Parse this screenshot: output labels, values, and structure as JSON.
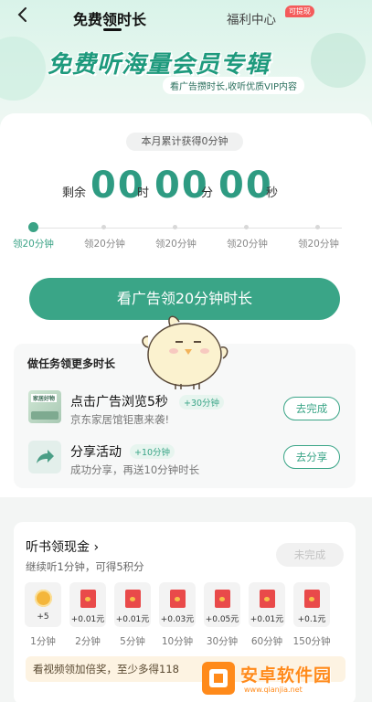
{
  "nav": {
    "back_icon": "chevron-left-icon",
    "tab_free": "免费领时长",
    "tab_welfare": "福利中心",
    "cash_tag": "可提现"
  },
  "hero": {
    "title": "免费听海量会员专辑",
    "subtitle": "看广告攒时长,收听优质VIP内容"
  },
  "timer": {
    "month_summary": "本月累计获得0分钟",
    "remain_label": "剩余",
    "hours": "00",
    "hour_unit": "时",
    "minutes": "00",
    "minute_unit": "分",
    "seconds": "00",
    "second_unit": "秒"
  },
  "progress": {
    "steps": [
      "领20分钟",
      "领20分钟",
      "领20分钟",
      "领20分钟",
      "领20分钟"
    ],
    "current_index": 0
  },
  "main_button": "看广告领20分钟时长",
  "tasks": {
    "title": "做任务领更多时长",
    "items": [
      {
        "name": "点击广告浏览5秒",
        "bonus": "+30分钟",
        "desc": "京东家居馆钜惠来袭!",
        "button": "去完成",
        "thumb_text": "家居好物"
      },
      {
        "name": "分享活动",
        "bonus": "+10分钟",
        "desc": "成功分享，再送10分钟时长",
        "button": "去分享",
        "icon": "share-icon"
      }
    ]
  },
  "reward": {
    "title": "听书领现金",
    "title_chevron": "›",
    "subtitle": "继续听1分钟，可得5积分",
    "button": "未完成",
    "slots": [
      {
        "value": "+5",
        "label": "1分钟",
        "type": "coin"
      },
      {
        "value": "+0.01元",
        "label": "2分钟",
        "type": "envelope"
      },
      {
        "value": "+0.01元",
        "label": "5分钟",
        "type": "envelope"
      },
      {
        "value": "+0.03元",
        "label": "10分钟",
        "type": "envelope"
      },
      {
        "value": "+0.05元",
        "label": "30分钟",
        "type": "envelope"
      },
      {
        "value": "+0.01元",
        "label": "60分钟",
        "type": "envelope"
      },
      {
        "value": "+0.1元",
        "label": "150分钟",
        "type": "envelope"
      }
    ],
    "banner": "看视频领加倍奖，至少多得118"
  },
  "watermark": {
    "text": "安卓软件园",
    "url": "www.qianjia.net"
  },
  "colors": {
    "accent": "#3aa587",
    "hero_title": "#1e9a7d",
    "red": "#e94a4a",
    "watermark": "#ff8a1a"
  }
}
